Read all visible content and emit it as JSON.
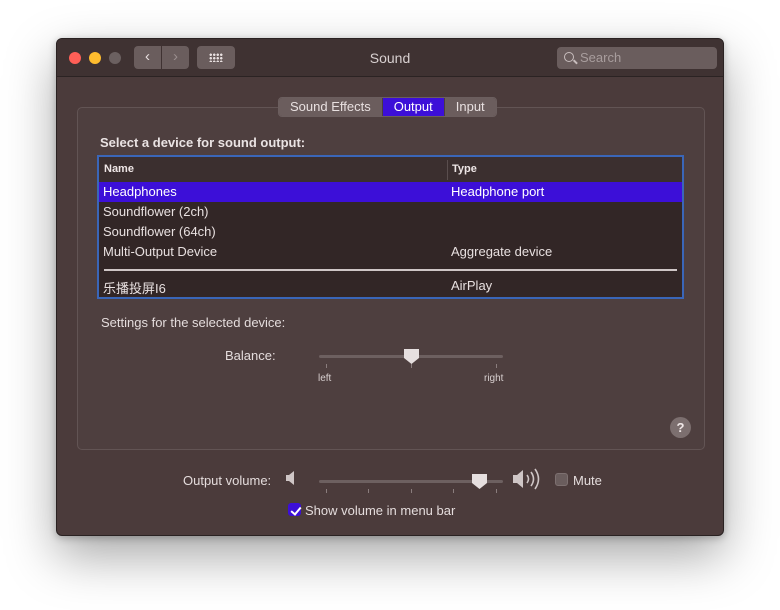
{
  "window": {
    "title": "Sound",
    "search_placeholder": "Search"
  },
  "tabs": [
    {
      "label": "Sound Effects",
      "active": false
    },
    {
      "label": "Output",
      "active": true
    },
    {
      "label": "Input",
      "active": false
    }
  ],
  "output": {
    "section_title": "Select a device for sound output:",
    "columns": {
      "name": "Name",
      "type": "Type"
    },
    "devices": [
      {
        "name": "Headphones",
        "type": "Headphone port",
        "selected": true
      },
      {
        "name": "Soundflower (2ch)",
        "type": ""
      },
      {
        "name": "Soundflower (64ch)",
        "type": ""
      },
      {
        "name": "Multi-Output Device",
        "type": "Aggregate device"
      },
      {
        "name": "乐播投屏I6",
        "type": "AirPlay"
      }
    ],
    "settings_label": "Settings for the selected device:",
    "balance": {
      "label": "Balance:",
      "left_label": "left",
      "right_label": "right",
      "value": 0.5
    }
  },
  "bottom": {
    "output_volume_label": "Output volume:",
    "volume_value": 0.9,
    "mute_label": "Mute",
    "mute_checked": false,
    "show_volume_label": "Show volume in menu bar",
    "show_volume_checked": true
  },
  "colors": {
    "accent": "#3c0fd8",
    "window_bg": "#4b3b3b",
    "table_border": "#3a66b8"
  }
}
